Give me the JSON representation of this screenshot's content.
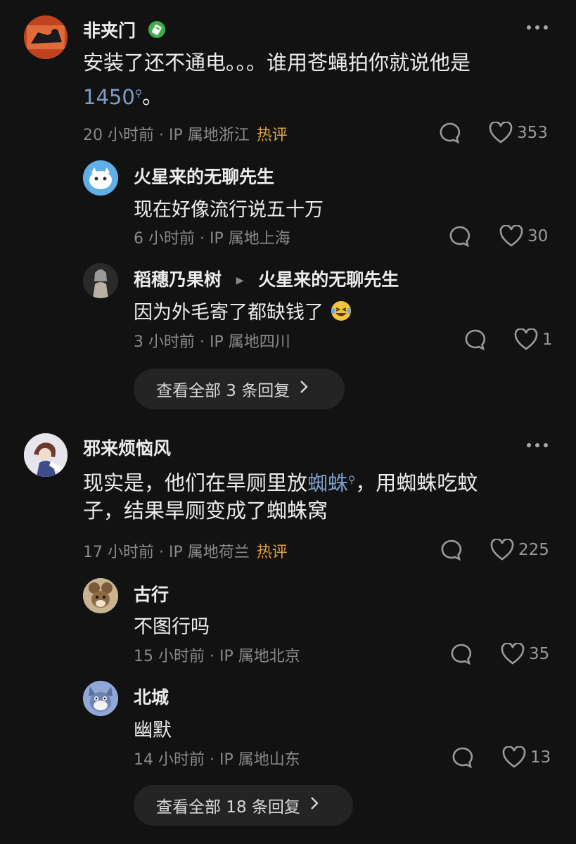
{
  "comments": [
    {
      "author": "非夹门",
      "text_line1": "安装了还不通电。。。谁用苍蝇拍你就说他是",
      "link": "1450",
      "text_line2_tail": "。",
      "time": "20 小时前",
      "ip": "IP 属地浙江",
      "hot": "热评",
      "likes": "353",
      "replies": [
        {
          "author": "火星来的无聊先生",
          "text": "现在好像流行说五十万",
          "time": "6 小时前",
          "ip": "IP 属地上海",
          "likes": "30"
        },
        {
          "author": "稻穗乃果树",
          "reply_to": "火星来的无聊先生",
          "text": "因为外毛寄了都缺钱了",
          "time": "3 小时前",
          "ip": "IP 属地四川",
          "likes": "1"
        }
      ],
      "view_all": "查看全部 3 条回复"
    },
    {
      "author": "邪来烦恼风",
      "text_line1_pre": "现实是，他们在旱厕里放",
      "link": "蜘蛛",
      "text_line1_post": "，用蜘蛛吃蚊",
      "text_line2": "子，结果旱厕变成了蜘蛛窝",
      "time": "17 小时前",
      "ip": "IP 属地荷兰",
      "hot": "热评",
      "likes": "225",
      "replies": [
        {
          "author": "古行",
          "text": "不图行吗",
          "time": "15 小时前",
          "ip": "IP 属地北京",
          "likes": "35"
        },
        {
          "author": "北城",
          "text": "幽默",
          "time": "14 小时前",
          "ip": "IP 属地山东",
          "likes": "13"
        }
      ],
      "view_all": "查看全部 18 条回复"
    }
  ],
  "colors": {
    "background": "#121212",
    "link": "#7b9ec9",
    "hot": "#e0a040",
    "badge": "#3fae49"
  },
  "icons": [
    "more-icon",
    "comment-icon",
    "heart-icon",
    "search-link-icon",
    "verified-badge-icon",
    "chevron-right-icon",
    "reply-arrow-icon",
    "laughing-emoji-icon"
  ]
}
